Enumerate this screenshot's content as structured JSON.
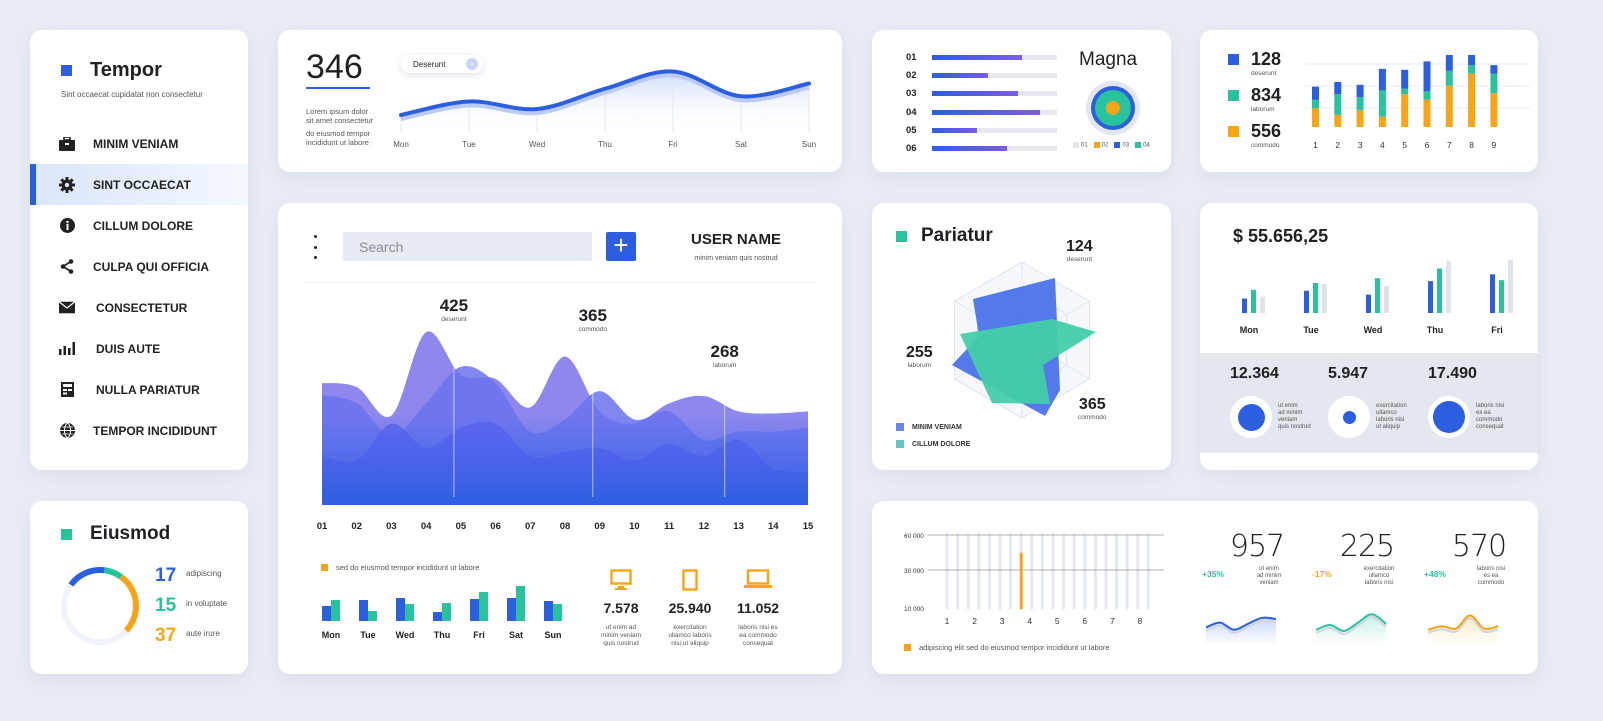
{
  "colors": {
    "blue": "#2b5fe0",
    "teal": "#28c39c",
    "orange": "#f7a516",
    "gray": "#e3e6ec",
    "purple": "#7c5ce6"
  },
  "sidebar": {
    "title": "Tempor",
    "subtitle": "Sint occaecat cupidatat non consectetur",
    "active_index": 1,
    "items": [
      {
        "label": "MINIM VENIAM",
        "icon": "briefcase-icon"
      },
      {
        "label": "SINT OCCAECAT",
        "icon": "gear-icon"
      },
      {
        "label": "CILLUM DOLORE",
        "icon": "info-icon"
      },
      {
        "label": "CULPA QUI OFFICIA",
        "icon": "share-icon"
      },
      {
        "label": "CONSECTETUR",
        "icon": "mail-icon"
      },
      {
        "label": "DUIS AUTE",
        "icon": "bar-chart-icon"
      },
      {
        "label": "NULLA PARIATUR",
        "icon": "calculator-icon"
      },
      {
        "label": "TEMPOR INCIDIDUNT",
        "icon": "globe-icon"
      }
    ]
  },
  "eiusmod": {
    "title": "Eiusmod",
    "stats": [
      {
        "value": "17",
        "label": "adipiscing",
        "color": "#2b5fe0"
      },
      {
        "value": "15",
        "label": "in voluptate",
        "color": "#28c39c"
      },
      {
        "value": "37",
        "label": "aute irure",
        "color": "#f7a516"
      }
    ]
  },
  "weekly": {
    "value": "346",
    "desc1": [
      "Lorem ipsum dolor",
      "sit amet consectetur"
    ],
    "desc2": [
      "do eiusmod tempor",
      "incididunt ut labore"
    ],
    "pill": "Deserunt"
  },
  "main": {
    "search_placeholder": "Search",
    "plus_label": "+",
    "user_name": "USER NAME",
    "user_sub": "minim veniam quis nostrud",
    "peaks": [
      {
        "value": "425",
        "label": "deserunt"
      },
      {
        "value": "365",
        "label": "commodo"
      },
      {
        "value": "268",
        "label": "laborum"
      }
    ],
    "bar_legend": "sed do eiusmod tempor incididunt ut labore",
    "devices": [
      {
        "icon": "monitor-icon",
        "value": "7.578",
        "desc": [
          "ut enim ad",
          "minim veniam",
          "quis nostrud"
        ]
      },
      {
        "icon": "tablet-icon",
        "value": "25.940",
        "desc": [
          "exercitation",
          "ullamco laboris",
          "nisi ut aliquip"
        ]
      },
      {
        "icon": "laptop-icon",
        "value": "11.052",
        "desc": [
          "laboris nisi es",
          "ea commodo",
          "consequat"
        ]
      }
    ]
  },
  "magna": {
    "title": "Magna"
  },
  "stacked_legend": [
    {
      "value": "128",
      "label": "deserunt",
      "color": "#2b5fe0"
    },
    {
      "value": "834",
      "label": "laborum",
      "color": "#28c39c"
    },
    {
      "value": "556",
      "label": "commodo",
      "color": "#f7a516"
    }
  ],
  "pariatur": {
    "title": "Pariatur",
    "labels": [
      {
        "value": "124",
        "label": "deserunt"
      },
      {
        "value": "255",
        "label": "laborum"
      },
      {
        "value": "365",
        "label": "commodo"
      }
    ],
    "legend": [
      {
        "label": "MINIM VENIAM",
        "color": "#6b84ea"
      },
      {
        "label": "CILLUM DOLORE",
        "color": "#67c6c0"
      }
    ]
  },
  "money": {
    "amount": "$ 55.656,25",
    "stats": [
      {
        "value": "12.364",
        "fill": 0.75,
        "desc": [
          "ut enim",
          "ad minim",
          "veniam",
          "quis nostrud"
        ]
      },
      {
        "value": "5.947",
        "fill": 0.35,
        "desc": [
          "exercitation",
          "ullamco",
          "laboris nisi",
          "ut aliquip"
        ]
      },
      {
        "value": "17.490",
        "fill": 0.9,
        "desc": [
          "laboris nisi",
          "ex ea",
          "commodo",
          "consequat"
        ]
      }
    ]
  },
  "bottom": {
    "legend": "adipiscing elit sed do eiusmod tempor incididunt ut labore",
    "kpis": [
      {
        "value": "957",
        "pct": "+35%",
        "pct_color": "#28c39c",
        "desc": [
          "ut enim",
          "ad minim",
          "veniam"
        ],
        "color": "#2b5fe0",
        "series": [
          0.4,
          0.6,
          0.3,
          0.55,
          0.8,
          0.75
        ]
      },
      {
        "value": "225",
        "pct": "-17%",
        "pct_color": "#f7a516",
        "desc": [
          "exercitation",
          "ullamco",
          "laboris nisi"
        ],
        "color": "#28c39c",
        "series": [
          0.3,
          0.5,
          0.25,
          0.6,
          0.95,
          0.55
        ]
      },
      {
        "value": "570",
        "pct": "+48%",
        "pct_color": "#28c39c",
        "desc": [
          "laboris nisi",
          "es ea",
          "commodo"
        ],
        "color": "#f7a516",
        "series": [
          0.3,
          0.45,
          0.35,
          0.9,
          0.35,
          0.45
        ]
      }
    ]
  },
  "chart_data": [
    {
      "id": "weekly-line",
      "type": "line",
      "categories": [
        "Mon",
        "Tue",
        "Wed",
        "Thu",
        "Fri",
        "Sat",
        "Sun"
      ],
      "values": [
        20,
        38,
        28,
        55,
        78,
        45,
        62
      ],
      "ylim": [
        0,
        100
      ]
    },
    {
      "id": "main-area",
      "type": "area",
      "categories": [
        "01",
        "02",
        "03",
        "04",
        "05",
        "06",
        "07",
        "08",
        "09",
        "10",
        "11",
        "12",
        "13",
        "14",
        "15"
      ],
      "series": [
        {
          "name": "layer1",
          "values": [
            300,
            290,
            220,
            425,
            320,
            310,
            240,
            365,
            230,
            200,
            250,
            268,
            230,
            225,
            230
          ]
        },
        {
          "name": "layer2",
          "values": [
            270,
            250,
            170,
            250,
            340,
            300,
            180,
            210,
            280,
            210,
            230,
            160,
            180,
            180,
            190
          ]
        },
        {
          "name": "layer3",
          "values": [
            120,
            110,
            200,
            140,
            190,
            200,
            120,
            130,
            140,
            110,
            150,
            120,
            160,
            90,
            80
          ]
        }
      ],
      "ylim": [
        0,
        500
      ]
    },
    {
      "id": "weekday-bars",
      "type": "bar",
      "categories": [
        "Mon",
        "Tue",
        "Wed",
        "Thu",
        "Fri",
        "Sat",
        "Sun"
      ],
      "series": [
        {
          "name": "blue",
          "values": [
            15,
            21,
            23,
            9,
            22,
            23,
            20
          ]
        },
        {
          "name": "teal",
          "values": [
            21,
            10,
            17,
            18,
            29,
            35,
            17
          ]
        }
      ],
      "ylim": [
        0,
        40
      ]
    },
    {
      "id": "magna-hbars",
      "type": "bar",
      "categories": [
        "01",
        "02",
        "03",
        "04",
        "05",
        "06"
      ],
      "values": [
        72,
        45,
        69,
        86,
        36,
        60
      ],
      "ylim": [
        0,
        100
      ]
    },
    {
      "id": "magna-donut",
      "type": "pie",
      "legend": [
        "01",
        "02",
        "03",
        "04"
      ],
      "colors": [
        "#e3e6ec",
        "#f7a516",
        "#2b5fe0",
        "#28c39c"
      ]
    },
    {
      "id": "stacked-bars",
      "type": "bar",
      "categories": [
        "1",
        "2",
        "3",
        "4",
        "5",
        "6",
        "7",
        "8",
        "9"
      ],
      "series": [
        {
          "name": "commodo",
          "values": [
            20,
            13,
            18,
            11,
            35,
            29,
            44,
            57,
            36
          ]
        },
        {
          "name": "laborum",
          "values": [
            9,
            22,
            14,
            28,
            6,
            9,
            16,
            9,
            21
          ]
        },
        {
          "name": "deserunt",
          "values": [
            14,
            13,
            13,
            23,
            20,
            32,
            17,
            13,
            9
          ]
        }
      ],
      "ylim": [
        0,
        80
      ]
    },
    {
      "id": "pariatur-radar",
      "type": "scatter",
      "axes": 6,
      "series": [
        {
          "name": "MINIM VENIAM",
          "values": [
            0.85,
            0.9,
            0.7,
            0.95,
            0.9,
            0.6
          ]
        },
        {
          "name": "CILLUM DOLORE",
          "values": [
            0.7,
            1.0,
            0.7,
            0.8,
            0.55,
            0.75
          ]
        }
      ]
    },
    {
      "id": "money-bars",
      "type": "bar",
      "categories": [
        "Mon",
        "Tue",
        "Wed",
        "Thu",
        "Fri"
      ],
      "series": [
        {
          "name": "blue",
          "values": [
            15,
            23,
            19,
            33,
            40
          ]
        },
        {
          "name": "teal",
          "values": [
            24,
            31,
            36,
            46,
            34
          ]
        },
        {
          "name": "gray",
          "values": [
            17,
            30,
            28,
            54,
            55
          ]
        }
      ],
      "ylim": [
        0,
        60
      ]
    },
    {
      "id": "bottom-bars",
      "type": "bar",
      "yticks": [
        "60 000",
        "30 000",
        "10 000"
      ],
      "categories": [
        "1",
        "2",
        "3",
        "4",
        "5",
        "6",
        "7",
        "8"
      ],
      "values": [
        17000,
        32000,
        28000,
        41000,
        28000,
        43000,
        41000,
        47000,
        39000,
        31000,
        41000,
        37000,
        28000,
        40000,
        36000,
        26000,
        34000,
        40000,
        30000,
        38000
      ],
      "highlight_index": 7,
      "ylim": [
        0,
        60000
      ]
    }
  ]
}
